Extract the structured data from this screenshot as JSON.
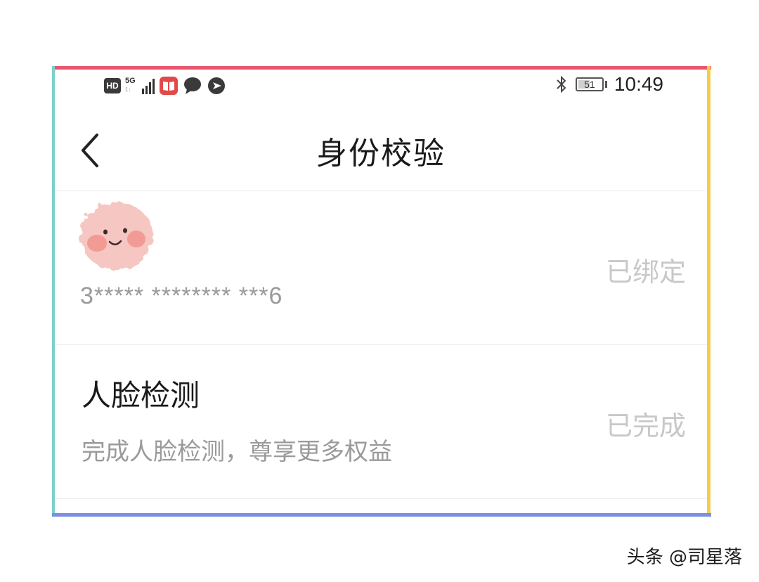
{
  "status_bar": {
    "hd_label": "HD",
    "network_label": "5G",
    "network_sub": "1↓",
    "battery_level": "51",
    "battery_fraction": 0.51,
    "time": "10:49",
    "icons": [
      "hd-icon",
      "signal-icon",
      "book-app-icon",
      "message-icon",
      "location-app-icon",
      "bluetooth-icon",
      "battery-icon"
    ]
  },
  "nav": {
    "title": "身份校验",
    "back_icon": "chevron-left-icon"
  },
  "bind_row": {
    "masked_id": "3***** ******** ***6",
    "status": "已绑定"
  },
  "face_row": {
    "title": "人脸检测",
    "subtitle": "完成人脸检测，尊享更多权益",
    "status": "已完成"
  },
  "watermark": "头条 @司星落",
  "colors": {
    "frame_top": "#e8566f",
    "frame_left": "#7ecfcc",
    "frame_right": "#f5cc4a",
    "frame_bottom": "#7b8fe0",
    "status_gray": "#c8c8c8",
    "secondary_text": "#9a9a9a"
  }
}
